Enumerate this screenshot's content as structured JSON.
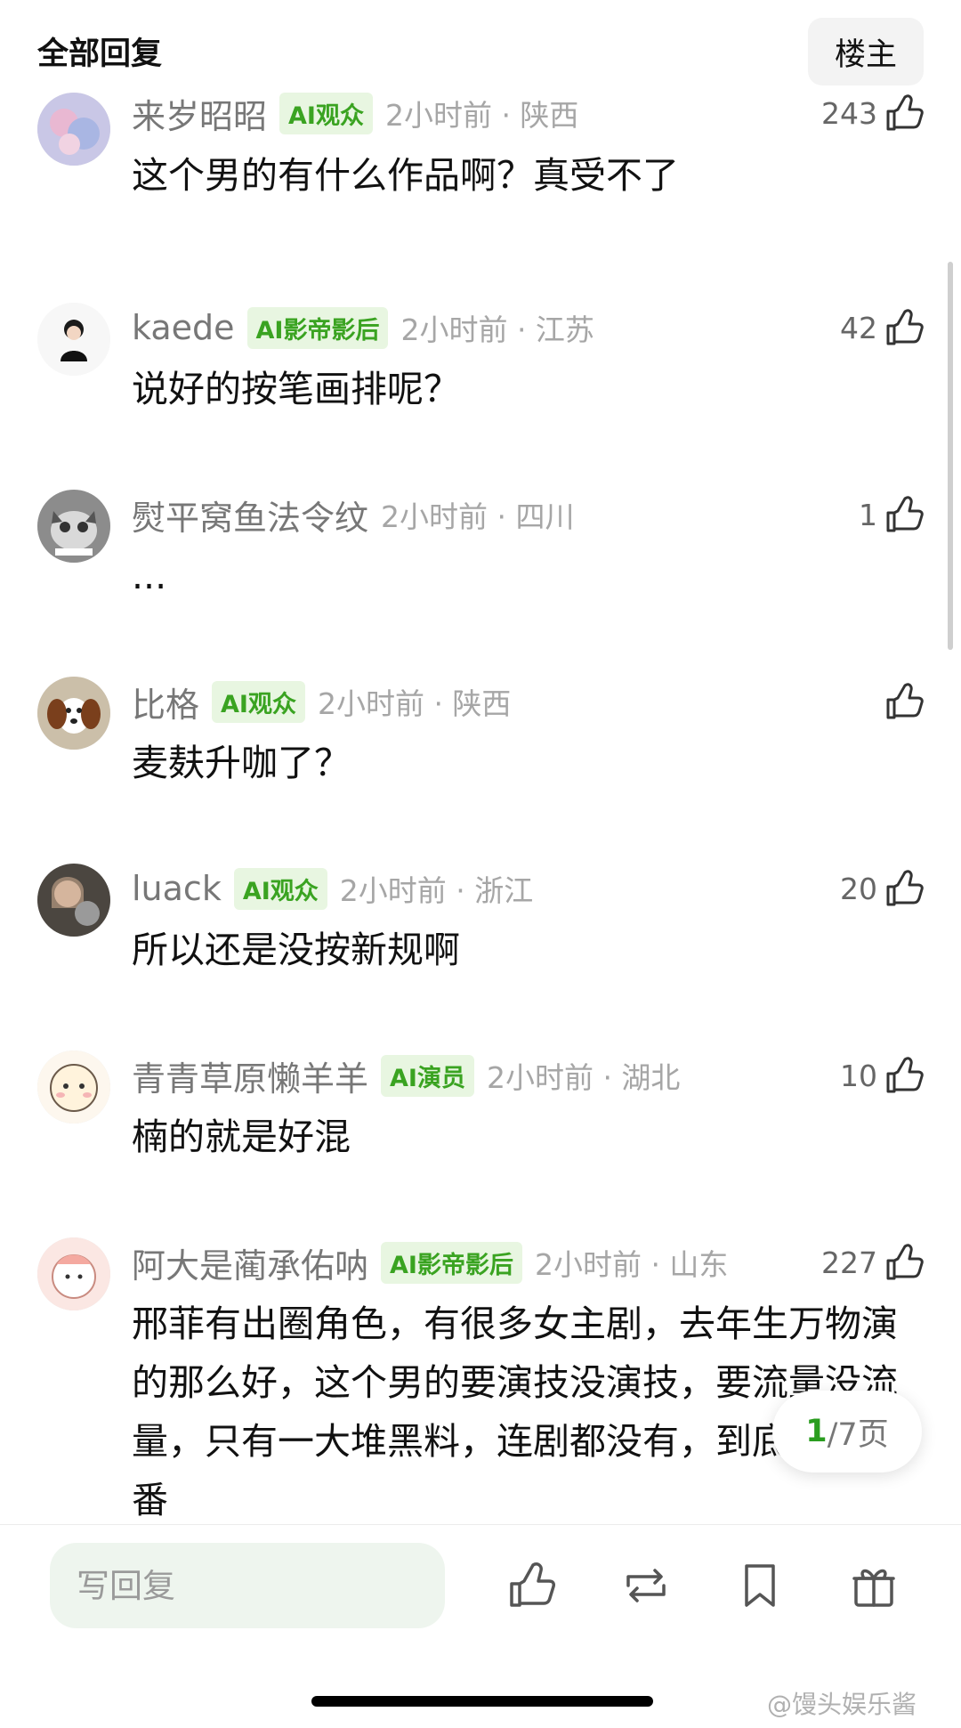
{
  "header": {
    "title": "全部回复",
    "owner_button": "楼主"
  },
  "comments": [
    {
      "username": "来岁昭昭",
      "badge": "AI观众",
      "time": "2小时前 · 陕西",
      "likes": "243",
      "text": "这个男的有什么作品啊？真受不了"
    },
    {
      "username": "kaede",
      "badge": "AI影帝影后",
      "time": "2小时前 · 江苏",
      "likes": "42",
      "text": "说好的按笔画排呢？"
    },
    {
      "username": "熨平窝鱼法令纹",
      "badge": "",
      "time": "2小时前 · 四川",
      "likes": "1",
      "text": "..."
    },
    {
      "username": "比格",
      "badge": "AI观众",
      "time": "2小时前 · 陕西",
      "likes": "",
      "text": "麦麸升咖了？"
    },
    {
      "username": "luack",
      "badge": "AI观众",
      "time": "2小时前 · 浙江",
      "likes": "20",
      "text": "所以还是没按新规啊"
    },
    {
      "username": "青青草原懒羊羊",
      "badge": "AI演员",
      "time": "2小时前 · 湖北",
      "likes": "10",
      "text": "楠的就是好混"
    },
    {
      "username": "阿大是蔺承佑呐",
      "badge": "AI影帝影后",
      "time": "2小时前 · 山东",
      "likes": "227",
      "text": "邢菲有出圈角色，有很多女主剧，去年生万物演的那么好，这个男的要演技没演技，要流量没流量，只有一大堆黑料，连剧都没有，到底凭啥平番"
    }
  ],
  "pagination": {
    "current": "1",
    "rest": "/7页"
  },
  "bottom_bar": {
    "reply_placeholder": "写回复"
  },
  "watermark": "@馒头娱乐酱",
  "colors": {
    "accent_green": "#2a9d1f",
    "badge_bg": "#e8f6e1",
    "badge_text": "#3aa321"
  }
}
